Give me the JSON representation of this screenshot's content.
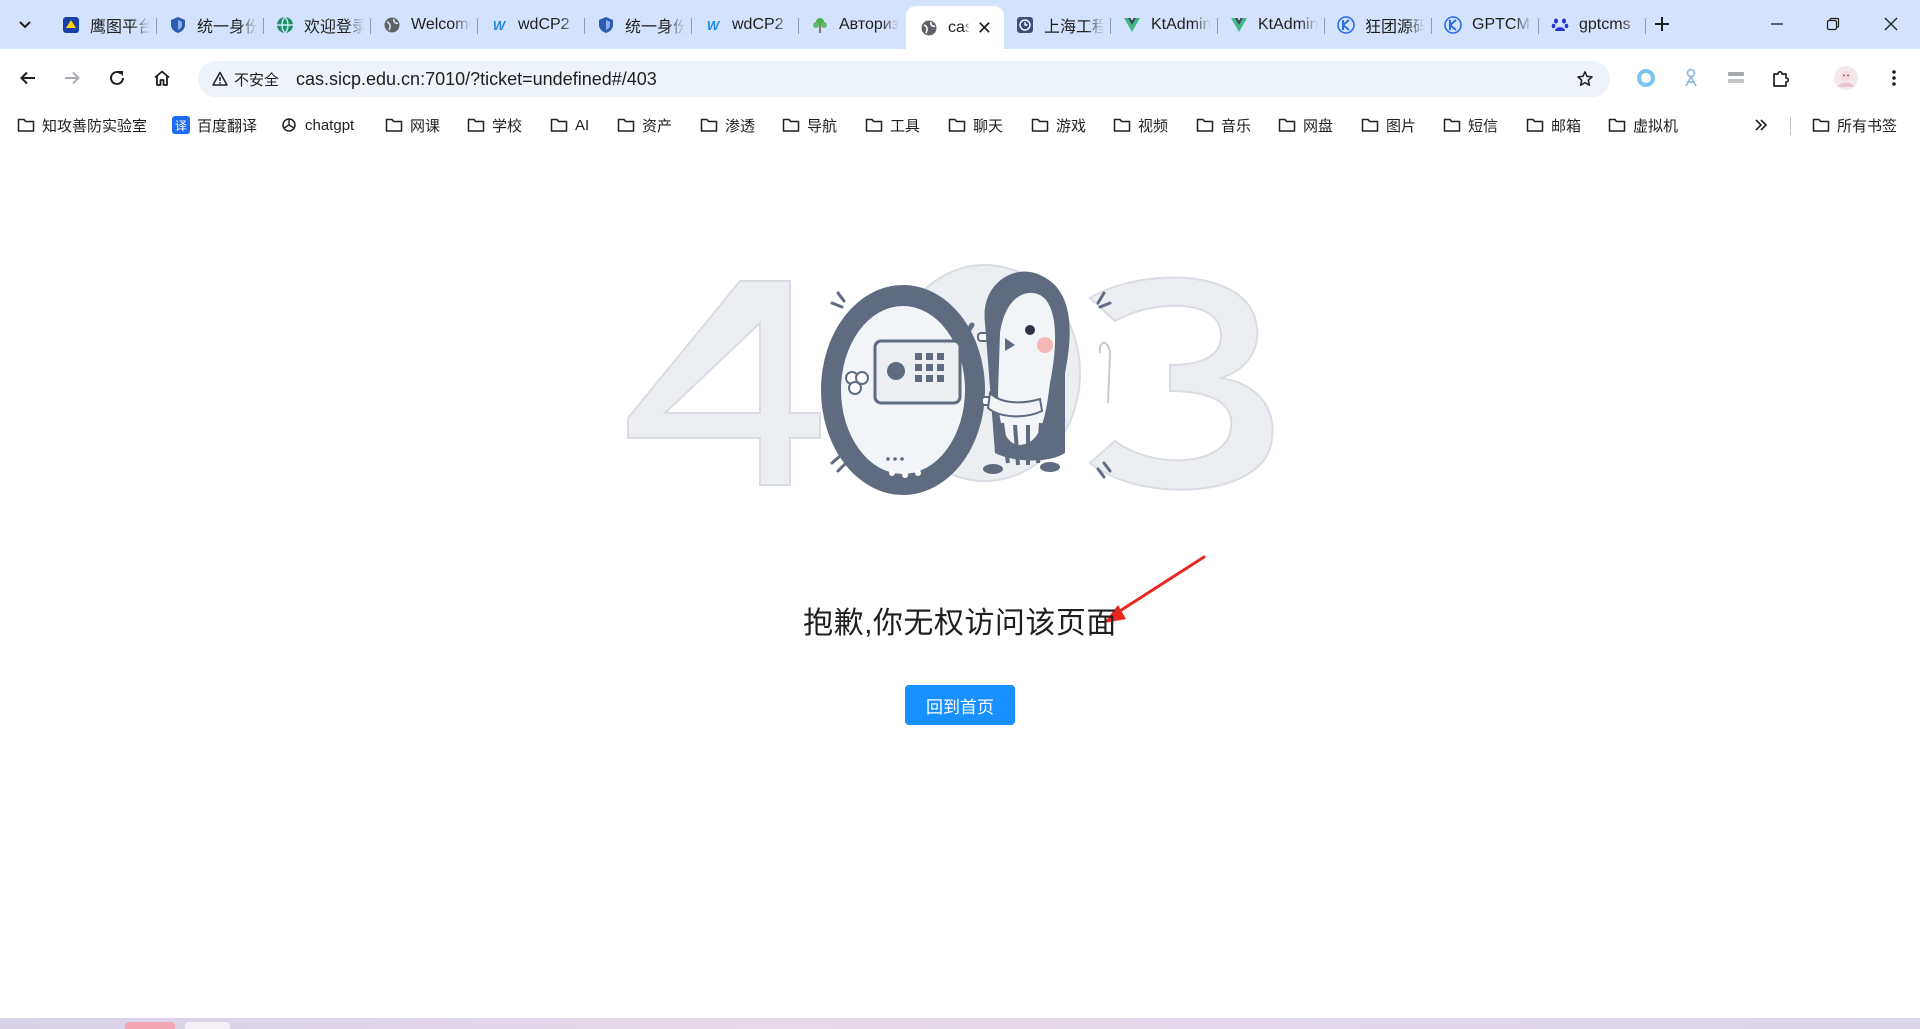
{
  "tabs": [
    {
      "title": "鹰图平台",
      "icon": "hunter-logo-icon",
      "active": false
    },
    {
      "title": "统一身份认证",
      "icon": "shield-icon",
      "active": false
    },
    {
      "title": "欢迎登录",
      "icon": "globe-colored-icon",
      "active": false
    },
    {
      "title": "Welcome",
      "icon": "globe-icon",
      "active": false
    },
    {
      "title": "wdCP2",
      "icon": "wdcp-icon",
      "active": false
    },
    {
      "title": "统一身份认证",
      "icon": "shield-icon",
      "active": false
    },
    {
      "title": "wdCP2",
      "icon": "wdcp-icon",
      "active": false
    },
    {
      "title": "Авторизация",
      "icon": "tree-icon",
      "active": false
    },
    {
      "title": "cas",
      "icon": "globe-icon",
      "active": true
    },
    {
      "title": "上海工程",
      "icon": "clock-icon",
      "active": false
    },
    {
      "title": "KtAdmin",
      "icon": "vue-icon",
      "active": false
    },
    {
      "title": "KtAdmin",
      "icon": "vue-icon",
      "active": false
    },
    {
      "title": "狂团源码",
      "icon": "k-logo-icon",
      "active": false
    },
    {
      "title": "GPTCMS",
      "icon": "k-logo-icon",
      "active": false
    },
    {
      "title": "gptcms",
      "icon": "baidu-paw-icon",
      "active": false
    }
  ],
  "window": {
    "minimize": "minimize-icon",
    "restore": "restore-icon",
    "close": "close-icon"
  },
  "toolbar": {
    "security_label": "不安全",
    "url": "cas.sicp.edu.cn:7010/?ticket=undefined#/403"
  },
  "bookmarks": [
    {
      "label": "知攻善防实验室",
      "icon": "folder-icon"
    },
    {
      "label": "百度翻译",
      "icon": "translate-icon"
    },
    {
      "label": "chatgpt",
      "icon": "openai-icon"
    },
    {
      "label": "网课",
      "icon": "folder-icon"
    },
    {
      "label": "学校",
      "icon": "folder-icon"
    },
    {
      "label": "AI",
      "icon": "folder-icon"
    },
    {
      "label": "资产",
      "icon": "folder-icon"
    },
    {
      "label": "渗透",
      "icon": "folder-icon"
    },
    {
      "label": "导航",
      "icon": "folder-icon"
    },
    {
      "label": "工具",
      "icon": "folder-icon"
    },
    {
      "label": "聊天",
      "icon": "folder-icon"
    },
    {
      "label": "游戏",
      "icon": "folder-icon"
    },
    {
      "label": "视频",
      "icon": "folder-icon"
    },
    {
      "label": "音乐",
      "icon": "folder-icon"
    },
    {
      "label": "网盘",
      "icon": "folder-icon"
    },
    {
      "label": "图片",
      "icon": "folder-icon"
    },
    {
      "label": "短信",
      "icon": "folder-icon"
    },
    {
      "label": "邮箱",
      "icon": "folder-icon"
    },
    {
      "label": "虚拟机",
      "icon": "folder-icon"
    }
  ],
  "all_bookmarks_label": "所有书签",
  "page": {
    "message": "抱歉,你无权访问该页面",
    "home_button": "回到首页"
  },
  "colors": {
    "tabstrip_bg": "#d3e3fd",
    "omnibox_bg": "#eef2f9",
    "primary_button": "#1890ff",
    "annotation_arrow": "#e8271e",
    "illustration_dark": "#5f6b80",
    "illustration_light": "#e8eaef"
  }
}
